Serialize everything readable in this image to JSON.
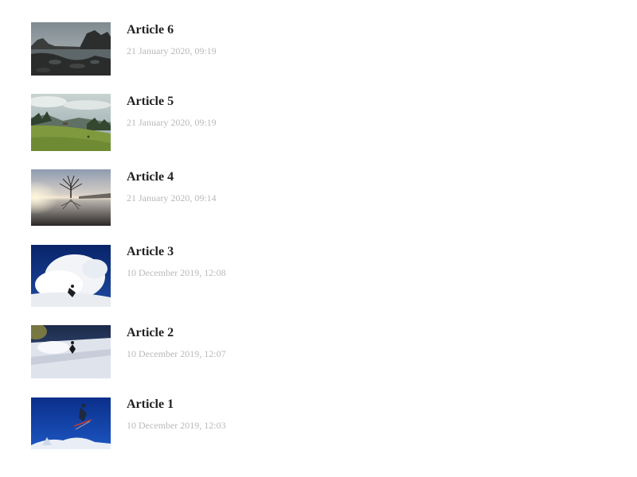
{
  "articles": [
    {
      "title": "Article 6",
      "date": "21 January 2020, 09:19",
      "thumbnail": "rocky-lake-shore-photo"
    },
    {
      "title": "Article 5",
      "date": "21 January 2020, 09:19",
      "thumbnail": "alpine-meadow-chalet-photo"
    },
    {
      "title": "Article 4",
      "date": "21 January 2020, 09:14",
      "thumbnail": "tree-in-lake-sunset-photo"
    },
    {
      "title": "Article 3",
      "date": "10 December 2019, 12:08",
      "thumbnail": "snowboard-powder-spray-photo"
    },
    {
      "title": "Article 2",
      "date": "10 December 2019, 12:07",
      "thumbnail": "skier-on-slope-photo"
    },
    {
      "title": "Article 1",
      "date": "10 December 2019, 12:03",
      "thumbnail": "ski-jump-blue-sky-photo"
    }
  ],
  "colors": {
    "title_text": "#222222",
    "date_text": "#b9b9b9",
    "background": "#ffffff"
  }
}
